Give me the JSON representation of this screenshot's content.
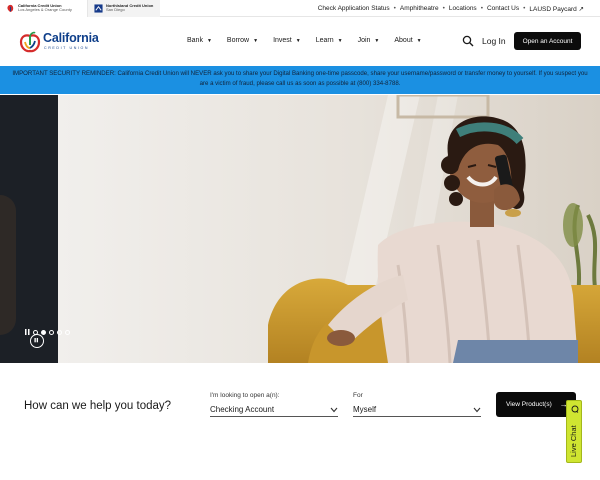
{
  "utility": {
    "brands": [
      {
        "name": "California Credit Union",
        "region": "Los Angeles & Orange County"
      },
      {
        "name": "NorthIsland Credit Union",
        "region": "San Diego"
      }
    ],
    "links": [
      "Check Application Status",
      "Amphitheatre",
      "Locations",
      "Contact Us",
      "LAUSD Paycard"
    ],
    "external_arrow": "↗"
  },
  "nav": {
    "logo_word": "California",
    "logo_sub": "CREDIT UNION",
    "items": [
      "Bank",
      "Borrow",
      "Invest",
      "Learn",
      "Join",
      "About"
    ],
    "login": "Log In",
    "open_account": "Open an Account"
  },
  "alert": {
    "text": "IMPORTANT SECURITY REMINDER: California Credit Union will NEVER ask you to share your Digital Banking one-time passcode, share your username/password or transfer money to yourself. If you suspect you are a victim of fraud, please call us as soon as possible at (800) 334-8788."
  },
  "hero": {
    "slide_count": 5,
    "active_slide": 1
  },
  "finder": {
    "question": "How can we help you today?",
    "open_label": "I'm looking to open a(n):",
    "open_value": "Checking Account",
    "for_label": "For",
    "for_value": "Myself",
    "button": "View Product(s)",
    "button_arrow": "→"
  },
  "livechat": {
    "label": "Live Chat"
  },
  "colors": {
    "alert_bg": "#1b90e2",
    "brand_blue": "#0f3f8a",
    "livechat_bg": "#cfe531",
    "button_bg": "#0a0a0a"
  }
}
